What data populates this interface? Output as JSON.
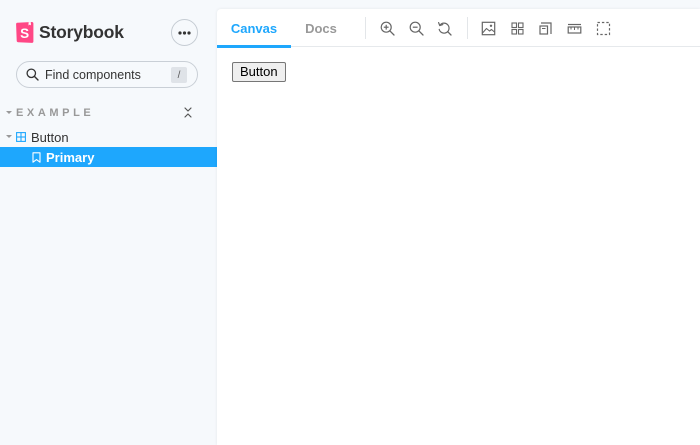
{
  "brand": {
    "name": "Storybook",
    "accent": "#ff4785"
  },
  "sidebar": {
    "menu_icon": "ellipsis-icon",
    "search": {
      "placeholder": "Find components",
      "shortcut": "/"
    },
    "group": {
      "label": "EXAMPLE",
      "collapse_icon": "collapse-all-icon"
    },
    "component": {
      "label": "Button",
      "icon": "component-grid-icon"
    },
    "story": {
      "label": "Primary",
      "icon": "bookmark-icon",
      "selected": true
    }
  },
  "toolbar": {
    "tabs": [
      {
        "label": "Canvas",
        "active": true
      },
      {
        "label": "Docs",
        "active": false
      }
    ],
    "tools": [
      "zoom-in-icon",
      "zoom-out-icon",
      "zoom-reset-icon",
      "background-icon",
      "grid-icon",
      "viewport-icon",
      "measure-icon",
      "outline-icon"
    ]
  },
  "preview": {
    "button_label": "Button"
  },
  "colors": {
    "primary": "#1ea7fd",
    "sidebar_bg": "#f6f9fc",
    "text": "#333333",
    "muted": "#999999"
  }
}
